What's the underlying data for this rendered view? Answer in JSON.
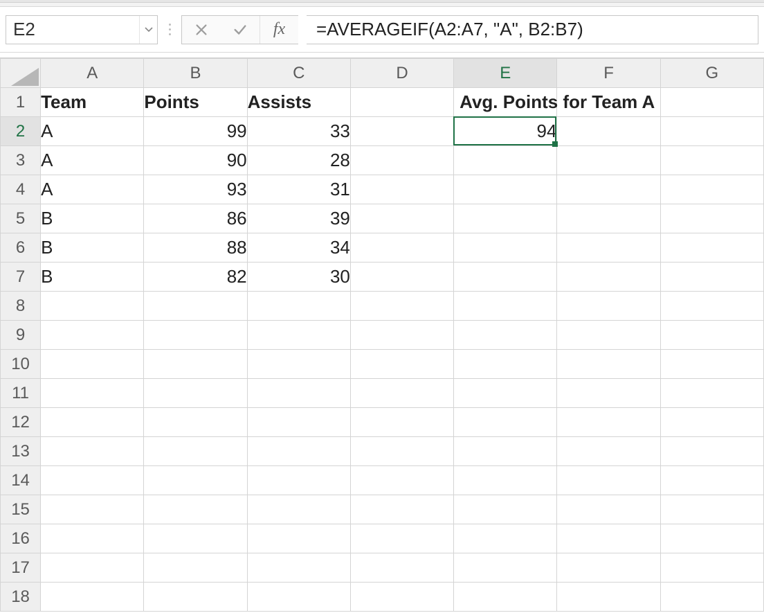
{
  "nameBox": {
    "value": "E2"
  },
  "formulaBar": {
    "fxLabel": "fx",
    "formula": "=AVERAGEIF(A2:A7, \"A\", B2:B7)"
  },
  "columns": [
    "A",
    "B",
    "C",
    "D",
    "E",
    "F",
    "G"
  ],
  "rows": [
    "1",
    "2",
    "3",
    "4",
    "5",
    "6",
    "7",
    "8",
    "9",
    "10",
    "11",
    "12",
    "13",
    "14",
    "15",
    "16",
    "17",
    "18"
  ],
  "activeCell": {
    "col": "E",
    "row": "2"
  },
  "cells": {
    "A1": {
      "value": "Team",
      "type": "text",
      "bold": true
    },
    "B1": {
      "value": "Points",
      "type": "text",
      "bold": true
    },
    "C1": {
      "value": "Assists",
      "type": "text",
      "bold": true
    },
    "E1": {
      "value": "Avg. Points for Team A",
      "type": "text",
      "bold": true,
      "overflow": true
    },
    "A2": {
      "value": "A",
      "type": "text"
    },
    "B2": {
      "value": "99",
      "type": "num"
    },
    "C2": {
      "value": "33",
      "type": "num"
    },
    "E2": {
      "value": "94",
      "type": "num"
    },
    "A3": {
      "value": "A",
      "type": "text"
    },
    "B3": {
      "value": "90",
      "type": "num"
    },
    "C3": {
      "value": "28",
      "type": "num"
    },
    "A4": {
      "value": "A",
      "type": "text"
    },
    "B4": {
      "value": "93",
      "type": "num"
    },
    "C4": {
      "value": "31",
      "type": "num"
    },
    "A5": {
      "value": "B",
      "type": "text"
    },
    "B5": {
      "value": "86",
      "type": "num"
    },
    "C5": {
      "value": "39",
      "type": "num"
    },
    "A6": {
      "value": "B",
      "type": "text"
    },
    "B6": {
      "value": "88",
      "type": "num"
    },
    "C6": {
      "value": "34",
      "type": "num"
    },
    "A7": {
      "value": "B",
      "type": "text"
    },
    "B7": {
      "value": "82",
      "type": "num"
    },
    "C7": {
      "value": "30",
      "type": "num"
    }
  },
  "colors": {
    "accent": "#1f7246"
  }
}
